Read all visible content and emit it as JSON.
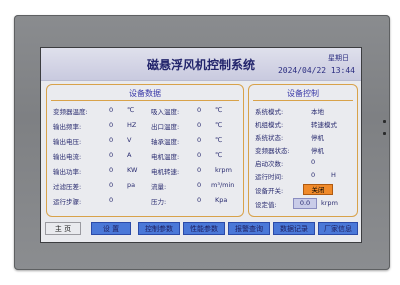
{
  "header": {
    "title": "磁悬浮风机控制系统",
    "weekday": "星期日",
    "datetime": "2024/04/22 13:44"
  },
  "device_data": {
    "title": "设备数据",
    "col1": [
      {
        "label": "变频器温度:",
        "value": "0",
        "unit": "℃"
      },
      {
        "label": "输出频率:",
        "value": "0",
        "unit": "HZ"
      },
      {
        "label": "输出电压:",
        "value": "0",
        "unit": "V"
      },
      {
        "label": "输出电流:",
        "value": "0",
        "unit": "A"
      },
      {
        "label": "输出功率:",
        "value": "0",
        "unit": "KW"
      },
      {
        "label": "过滤压差:",
        "value": "0",
        "unit": "pa"
      },
      {
        "label": "运行步骤:",
        "value": "0",
        "unit": ""
      }
    ],
    "col2": [
      {
        "label": "吸入温度:",
        "value": "0",
        "unit": "℃"
      },
      {
        "label": "出口温度:",
        "value": "0",
        "unit": "℃"
      },
      {
        "label": "轴承温度:",
        "value": "0",
        "unit": "℃"
      },
      {
        "label": "电机温度:",
        "value": "0",
        "unit": "℃"
      },
      {
        "label": "电机转速:",
        "value": "0",
        "unit": "krpm"
      },
      {
        "label": "流量:",
        "value": "0",
        "unit": "m³/min"
      },
      {
        "label": "压力:",
        "value": "0",
        "unit": "Kpa"
      }
    ]
  },
  "device_control": {
    "title": "设备控制",
    "rows": [
      {
        "label": "系统模式:",
        "value": "本地"
      },
      {
        "label": "机组模式:",
        "value": "转速模式"
      },
      {
        "label": "系统状态:",
        "value": "停机"
      },
      {
        "label": "变频器状态:",
        "value": "停机"
      },
      {
        "label": "启动次数:",
        "value": "0"
      },
      {
        "label": "运行时间:",
        "value": "0",
        "unit": "H"
      }
    ],
    "switch_label": "设备开关:",
    "switch_button": "关闭",
    "setpoint_label": "设定值:",
    "setpoint_value": "0.0",
    "setpoint_unit": "krpm"
  },
  "nav": {
    "home": "主  页",
    "settings": "设  置",
    "control_params": "控制参数",
    "performance_params": "性能参数",
    "alarm_query": "报警查询",
    "data_record": "数据记录",
    "vendor_info": "厂家信息"
  }
}
